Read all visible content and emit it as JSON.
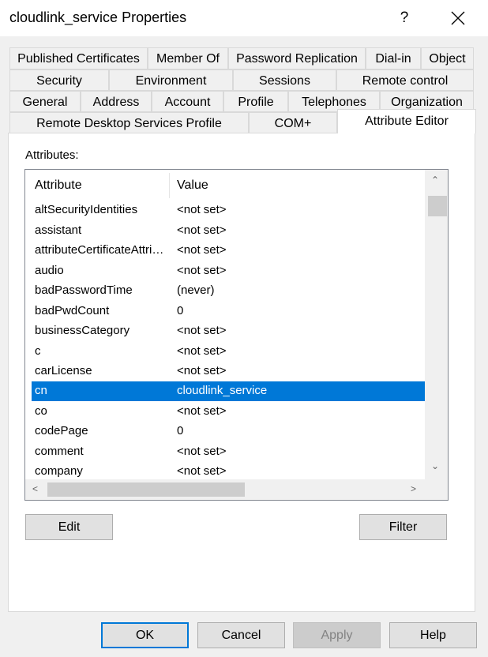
{
  "window": {
    "title": "cloudlink_service Properties",
    "help_glyph": "?",
    "close_icon": "close-icon"
  },
  "tabs": {
    "row1": [
      "Published Certificates",
      "Member Of",
      "Password Replication",
      "Dial-in",
      "Object"
    ],
    "row2": [
      "Security",
      "Environment",
      "Sessions",
      "Remote control"
    ],
    "row3": [
      "General",
      "Address",
      "Account",
      "Profile",
      "Telephones",
      "Organization"
    ],
    "row4": [
      "Remote Desktop Services Profile",
      "COM+",
      "Attribute Editor"
    ],
    "active": "Attribute Editor"
  },
  "attributes_label": "Attributes:",
  "list": {
    "columns": [
      "Attribute",
      "Value"
    ],
    "rows": [
      [
        "altSecurityIdentities",
        "<not set>"
      ],
      [
        "assistant",
        "<not set>"
      ],
      [
        "attributeCertificateAttribute",
        "<not set>"
      ],
      [
        "audio",
        "<not set>"
      ],
      [
        "badPasswordTime",
        "(never)"
      ],
      [
        "badPwdCount",
        "0"
      ],
      [
        "businessCategory",
        "<not set>"
      ],
      [
        "c",
        "<not set>"
      ],
      [
        "carLicense",
        "<not set>"
      ],
      [
        "cn",
        "cloudlink_service"
      ],
      [
        "co",
        "<not set>"
      ],
      [
        "codePage",
        "0"
      ],
      [
        "comment",
        "<not set>"
      ],
      [
        "company",
        "<not set>"
      ]
    ],
    "selected_index": 9
  },
  "buttons": {
    "edit": "Edit",
    "filter": "Filter",
    "ok": "OK",
    "cancel": "Cancel",
    "apply": "Apply",
    "help": "Help"
  },
  "colors": {
    "selection": "#0078d7",
    "default_button_border": "#0078d7"
  }
}
